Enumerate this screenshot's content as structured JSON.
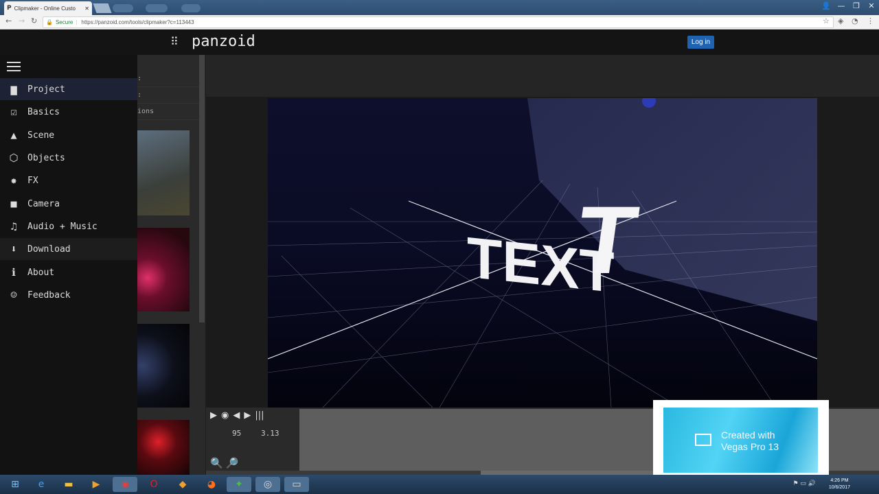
{
  "browser": {
    "tab_title": "Clipmaker - Online Custo",
    "secure_label": "Secure",
    "url": "https://panzoid.com/tools/clipmaker?c=113443",
    "tab_close": "✕",
    "window_controls": [
      "👤",
      "—",
      "❐",
      "✕"
    ]
  },
  "header": {
    "logo": "panzoid",
    "login_label": "Log in",
    "accent": "#1f63b0"
  },
  "sidebar": {
    "items": [
      {
        "icon": "folder-icon",
        "glyph": "▆",
        "label": "Project",
        "state": "selected"
      },
      {
        "icon": "checkbox-icon",
        "glyph": "☑",
        "label": "Basics"
      },
      {
        "icon": "mountain-icon",
        "glyph": "▲",
        "label": "Scene"
      },
      {
        "icon": "cube-icon",
        "glyph": "⬡",
        "label": "Objects"
      },
      {
        "icon": "burst-icon",
        "glyph": "✸",
        "label": "FX"
      },
      {
        "icon": "camera-icon",
        "glyph": "■",
        "label": "Camera"
      },
      {
        "icon": "music-icon",
        "glyph": "♫",
        "label": "Audio + Music"
      },
      {
        "icon": "download-icon",
        "glyph": "⬇",
        "label": "Download",
        "state": "hover"
      },
      {
        "icon": "info-icon",
        "glyph": "ℹ",
        "label": "About"
      },
      {
        "icon": "smiley-icon",
        "glyph": "☺",
        "label": "Feedback"
      }
    ]
  },
  "list_panel": {
    "rows": [
      ":",
      ":",
      "ions"
    ]
  },
  "preview": {
    "text_3d": "TEXT",
    "text_3d_big": "T"
  },
  "timeline": {
    "frame": "95",
    "time": "3.13"
  },
  "watermark": {
    "line1": "Created with",
    "line2": "Vegas Pro 13"
  },
  "taskbar": {
    "time": "4:26 PM",
    "date": "10/6/2017"
  }
}
